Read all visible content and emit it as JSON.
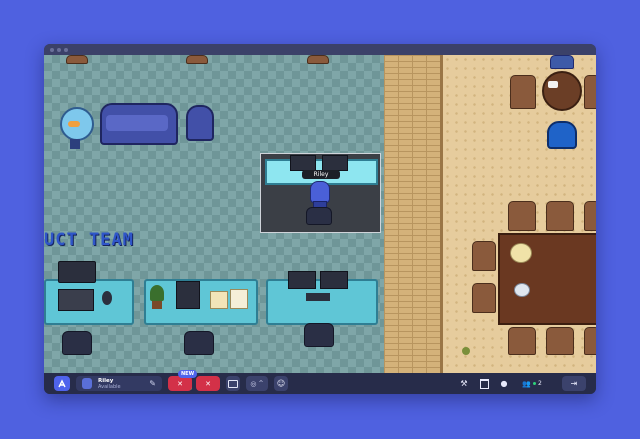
{
  "map": {
    "zone_label": "UCT TEAM",
    "avatar_name": "Riley"
  },
  "toolbar": {
    "user_name": "Riley",
    "user_status": "Available",
    "new_badge": "NEW",
    "participant_count": "2"
  },
  "colors": {
    "background": "#4f61e0",
    "toolbar": "#272c4a",
    "accent": "#4f63ec",
    "danger": "#d33148",
    "online": "#2fd27a"
  }
}
